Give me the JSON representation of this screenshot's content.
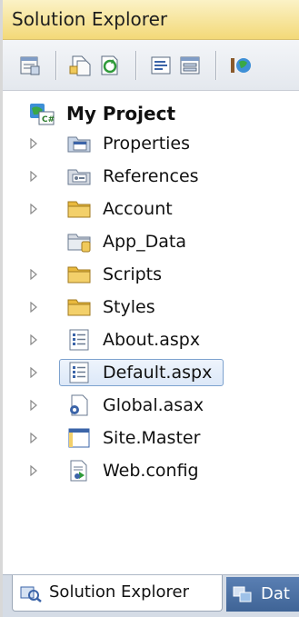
{
  "window": {
    "title": "Solution Explorer"
  },
  "toolbar": {
    "buttons": [
      {
        "name": "properties-button",
        "icon": "properties-icon"
      },
      {
        "name": "show-all-files-button",
        "icon": "show-all-files-icon"
      },
      {
        "name": "refresh-button",
        "icon": "refresh-icon"
      },
      {
        "name": "view-code-button",
        "icon": "view-code-icon"
      },
      {
        "name": "view-designer-button",
        "icon": "view-designer-icon"
      },
      {
        "name": "copy-web-site-button",
        "icon": "copy-web-site-icon"
      }
    ]
  },
  "tree": {
    "root": {
      "label": "My Project",
      "icon": "web-project-icon"
    },
    "items": [
      {
        "label": "Properties",
        "icon": "properties-folder-icon",
        "expandable": true
      },
      {
        "label": "References",
        "icon": "references-icon",
        "expandable": true
      },
      {
        "label": "Account",
        "icon": "folder-icon",
        "expandable": true
      },
      {
        "label": "App_Data",
        "icon": "app-data-folder-icon",
        "expandable": false
      },
      {
        "label": "Scripts",
        "icon": "folder-icon",
        "expandable": true
      },
      {
        "label": "Styles",
        "icon": "folder-icon",
        "expandable": true
      },
      {
        "label": "About.aspx",
        "icon": "aspx-file-icon",
        "expandable": true
      },
      {
        "label": "Default.aspx",
        "icon": "aspx-file-icon",
        "expandable": true,
        "selected": true
      },
      {
        "label": "Global.asax",
        "icon": "global-asax-icon",
        "expandable": true
      },
      {
        "label": "Site.Master",
        "icon": "master-page-icon",
        "expandable": true
      },
      {
        "label": "Web.config",
        "icon": "web-config-icon",
        "expandable": true
      }
    ]
  },
  "bottom_tabs": {
    "active_label": "Solution Explorer",
    "other_label": "Dat"
  },
  "colors": {
    "title_bar": "#f3d978",
    "selection_border": "#7da2ce",
    "folder": "#f0c95a",
    "inactive_tab": "#4a6fa5"
  }
}
